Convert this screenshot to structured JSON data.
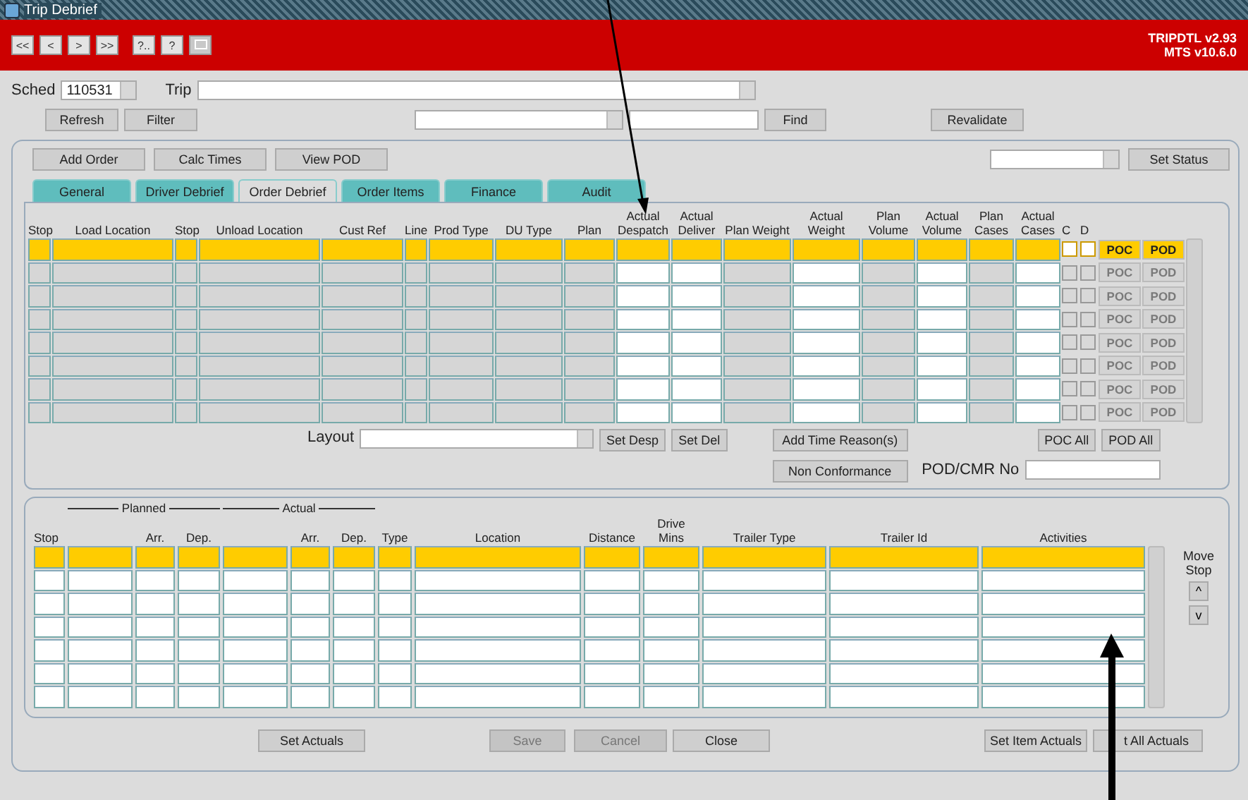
{
  "window": {
    "title": "Trip Debrief"
  },
  "toolbar": {
    "buttons": [
      {
        "kind": "text",
        "label": "<<",
        "disabled": false
      },
      {
        "kind": "text",
        "label": "<",
        "disabled": false
      },
      {
        "kind": "text",
        "label": ">",
        "disabled": false
      },
      {
        "kind": "text",
        "label": ">>",
        "disabled": false
      },
      {
        "kind": "text",
        "label": "?..",
        "disabled": false
      },
      {
        "kind": "text",
        "label": "?",
        "disabled": false
      },
      {
        "kind": "icon",
        "disabled": true
      }
    ],
    "version": "TRIPDTL v2.93",
    "system": "MTS v10.6.0"
  },
  "header": {
    "sched_label": "Sched",
    "sched_value": "110531",
    "trip_label": "Trip",
    "refresh_button": "Refresh",
    "filter_button": "Filter",
    "find_button": "Find",
    "revalidate_button": "Revalidate"
  },
  "actions": [
    "Add Order",
    "Calc Times",
    "View POD"
  ],
  "set_status_button": "Set Status",
  "tabs": [
    {
      "label": "General",
      "selected": false
    },
    {
      "label": "Driver Debrief",
      "selected": false
    },
    {
      "label": "Order Debrief",
      "selected": true
    },
    {
      "label": "Order Items",
      "selected": false
    },
    {
      "label": "Finance",
      "selected": false
    },
    {
      "label": "Audit",
      "selected": false
    }
  ],
  "orders": {
    "columns": [
      {
        "label": "Stop",
        "kind": "display"
      },
      {
        "label": "Load Location",
        "kind": "display"
      },
      {
        "label": "Stop",
        "kind": "display"
      },
      {
        "label": "Unload Location",
        "kind": "display"
      },
      {
        "label": "Cust Ref",
        "kind": "display"
      },
      {
        "label": "Line",
        "kind": "display"
      },
      {
        "label": "Prod Type",
        "kind": "display"
      },
      {
        "label": "DU Type",
        "kind": "display"
      },
      {
        "label": "Plan",
        "kind": "display"
      },
      {
        "label": "Actual Despatch",
        "kind": "input"
      },
      {
        "label": "Actual Deliver",
        "kind": "input"
      },
      {
        "label": "Plan Weight",
        "kind": "display"
      },
      {
        "label": "Actual Weight",
        "kind": "input"
      },
      {
        "label": "Plan Volume",
        "kind": "display"
      },
      {
        "label": "Actual Volume",
        "kind": "input"
      },
      {
        "label": "Plan Cases",
        "kind": "display"
      },
      {
        "label": "Actual Cases",
        "kind": "input"
      }
    ],
    "check_labels": [
      "C",
      "D"
    ],
    "rows": [
      {
        "selected": true,
        "c_checked": false,
        "d_checked": false,
        "buttons_enabled": true,
        "poc": "POC",
        "pod": "POD"
      },
      {
        "selected": false,
        "c_checked": false,
        "d_checked": false,
        "buttons_enabled": false,
        "poc": "POC",
        "pod": "POD"
      },
      {
        "selected": false,
        "c_checked": false,
        "d_checked": false,
        "buttons_enabled": false,
        "poc": "POC",
        "pod": "POD"
      },
      {
        "selected": false,
        "c_checked": false,
        "d_checked": false,
        "buttons_enabled": false,
        "poc": "POC",
        "pod": "POD"
      },
      {
        "selected": false,
        "c_checked": false,
        "d_checked": false,
        "buttons_enabled": false,
        "poc": "POC",
        "pod": "POD"
      },
      {
        "selected": false,
        "c_checked": false,
        "d_checked": false,
        "buttons_enabled": false,
        "poc": "POC",
        "pod": "POD"
      },
      {
        "selected": false,
        "c_checked": false,
        "d_checked": false,
        "buttons_enabled": false,
        "poc": "POC",
        "pod": "POD"
      },
      {
        "selected": false,
        "c_checked": false,
        "d_checked": false,
        "buttons_enabled": false,
        "poc": "POC",
        "pod": "POD"
      }
    ],
    "layout_label": "Layout",
    "set_desp_button": "Set Desp",
    "set_del_button": "Set Del",
    "add_time_reason_button": "Add Time Reason(s)",
    "non_conformance_button": "Non Conformance",
    "poc_all_button": "POC All",
    "pod_all_button": "POD All",
    "pod_cmr_label": "POD/CMR No"
  },
  "stops": {
    "group_headers": [
      "Planned",
      "Actual"
    ],
    "columns": [
      "Stop",
      "",
      "Arr.",
      "Dep.",
      "",
      "Arr.",
      "Dep.",
      "Type",
      "Location",
      "Distance",
      "Drive Mins",
      "Trailer Type",
      "Trailer Id",
      "Activities"
    ],
    "rows": [
      {
        "selected": true
      },
      {
        "selected": false
      },
      {
        "selected": false
      },
      {
        "selected": false
      },
      {
        "selected": false
      },
      {
        "selected": false
      },
      {
        "selected": false
      }
    ],
    "move_stop_label": "Move Stop",
    "up_button": "^",
    "down_button": "v"
  },
  "footer_buttons": [
    {
      "label": "Set Actuals",
      "disabled": false
    },
    {
      "label": "Save",
      "disabled": true
    },
    {
      "label": "Cancel",
      "disabled": true
    },
    {
      "label": "Close",
      "disabled": false
    },
    {
      "label": "Set Item Actuals",
      "disabled": false
    },
    {
      "label": "t All Actuals",
      "disabled": false
    }
  ]
}
